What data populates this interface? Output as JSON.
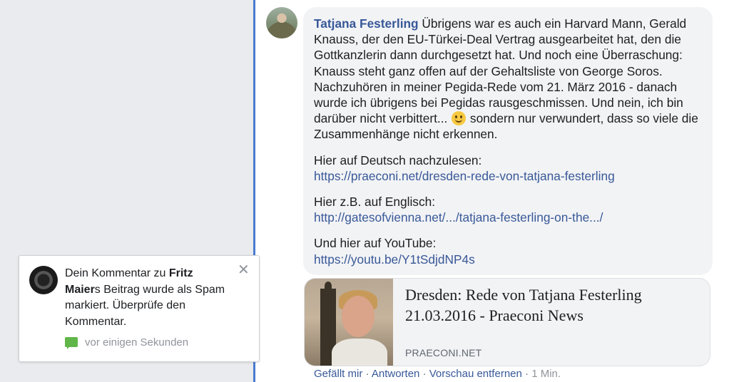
{
  "comment": {
    "author": "Tatjana Festerling",
    "paragraph1_before_emoji": " Übrigens war es auch ein Harvard Mann, Gerald Knauss, der den EU-Türkei-Deal Vertrag ausgearbeitet hat, den die Gottkanzlerin dann durchgesetzt hat. Und noch eine Überraschung: Knauss steht ganz offen auf der Gehaltsliste von George Soros. Nachzuhören in meiner Pegida-Rede vom 21. März 2016 - danach wurde ich übrigens bei Pegidas rausgeschmissen. Und nein, ich bin darüber nicht verbittert...",
    "emoji": "smiley-emoji",
    "paragraph1_after_emoji": " sondern nur verwundert, dass so viele die Zusammenhänge nicht erkennen.",
    "german_label": "Hier auf Deutsch nachzulesen:",
    "german_link": "https://praeconi.net/dresden-rede-von-tatjana-festerling",
    "english_label": "Hier z.B. auf Englisch:",
    "english_link": "http://gatesofvienna.net/.../tatjana-festerling-on-the.../",
    "youtube_label": "Und hier auf YouTube:",
    "youtube_link": "https://youtu.be/Y1tSdjdNP4s"
  },
  "preview": {
    "title": "Dresden: Rede von Tatjana Festerling 21.03.2016 - Praeconi News",
    "domain": "PRAECONI.NET"
  },
  "actions": {
    "like": "Gefällt mir",
    "reply": "Antworten",
    "remove_preview": "Vorschau entfernen",
    "time": "1 Min.",
    "separator": " · "
  },
  "notification": {
    "text_part1": "Dein Kommentar zu ",
    "bold_name": "Fritz Maier",
    "text_part2": "s Beitrag wurde als Spam markiert. Überprüfe den Kommentar.",
    "close_symbol": "✕",
    "time": "vor einigen Sekunden"
  },
  "colors": {
    "link_blue": "#385898",
    "thread_line": "#4a7bd0",
    "chat_icon_green": "#61b64a"
  }
}
